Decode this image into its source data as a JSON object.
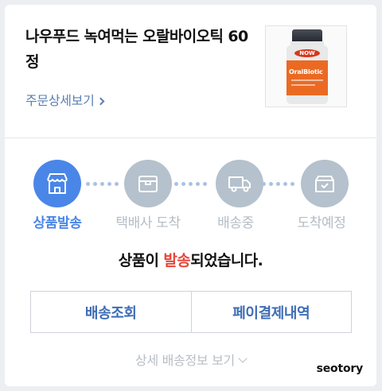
{
  "product": {
    "title": "나우푸드 녹여먹는 오랄바이오틱 60정",
    "detail_link": "주문상세보기",
    "image": {
      "brand": "NOW",
      "name": "OralBiotic"
    }
  },
  "steps": [
    {
      "label": "상품발송",
      "active": true,
      "icon": "store-icon"
    },
    {
      "label": "택배사 도착",
      "active": false,
      "icon": "box-icon"
    },
    {
      "label": "배송중",
      "active": false,
      "icon": "truck-icon"
    },
    {
      "label": "도착예정",
      "active": false,
      "icon": "package-check-icon"
    }
  ],
  "status": {
    "prefix": "상품이 ",
    "highlight": "발송",
    "suffix": "되었습니다."
  },
  "colors": {
    "accent": "#4a86e8",
    "highlight": "#e8463a",
    "inactive": "#b5c1cc"
  },
  "buttons": {
    "track": "배송조회",
    "pay_history": "페이결제내역"
  },
  "more_info": "상세 배송정보 보기",
  "watermark": "seotory"
}
